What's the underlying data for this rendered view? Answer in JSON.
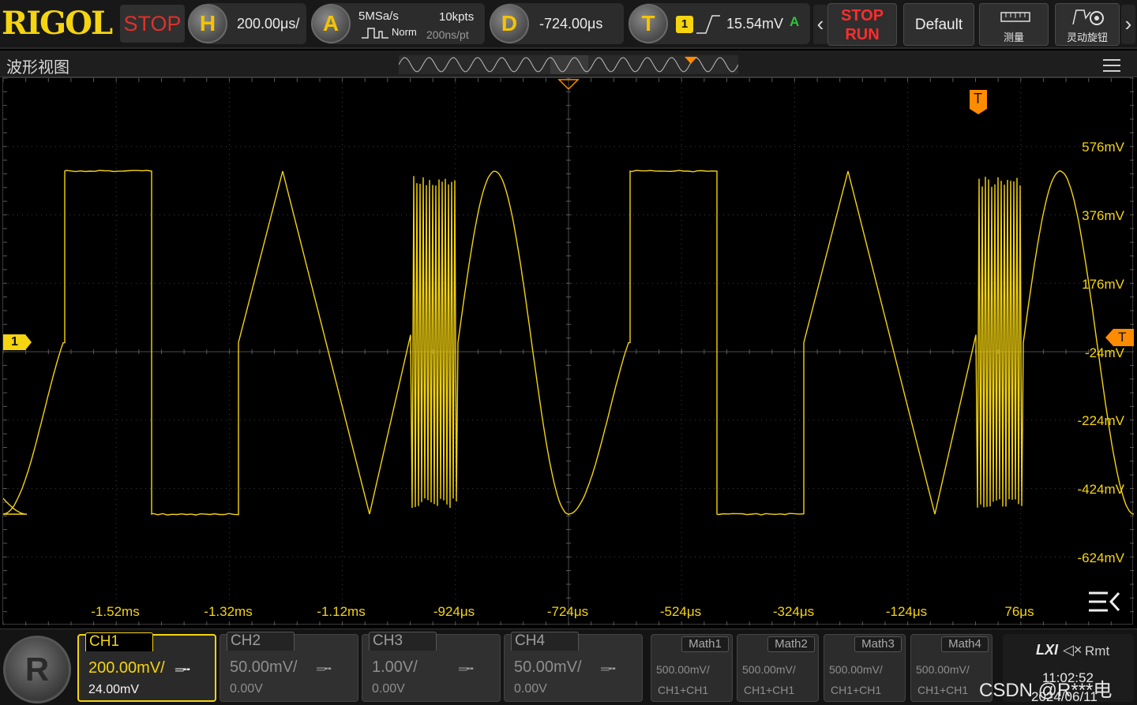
{
  "brand": "RIGOL",
  "run_state": "STOP",
  "horizontal": {
    "letter": "H",
    "timebase": "200.00μs/"
  },
  "acquire": {
    "letter": "A",
    "sample_rate": "5MSa/s",
    "memory_depth": "10kpts",
    "mode": "Norm",
    "resolution": "200ns/pt"
  },
  "delay": {
    "letter": "D",
    "value": "-724.00μs"
  },
  "trigger": {
    "letter": "T",
    "source": "1",
    "level": "15.54mV",
    "status": "A"
  },
  "buttons": {
    "stop_label": "STOP",
    "run_label": "RUN",
    "default_label": "Default",
    "measure_label": "测量",
    "knob_label": "灵动旋钮"
  },
  "view_title": "波形视图",
  "channel_marker": "1",
  "trigger_marker": "T",
  "v_labels": [
    "576mV",
    "376mV",
    "176mV",
    "-24mV",
    "-224mV",
    "-424mV",
    "-624mV"
  ],
  "t_labels": [
    "-1.52ms",
    "-1.32ms",
    "-1.12ms",
    "-924μs",
    "-724μs",
    "-524μs",
    "-324μs",
    "-124μs",
    "76μs"
  ],
  "channels": [
    {
      "name": "CH1",
      "scale": "200.00mV/",
      "offset": "24.00mV",
      "coupling": "DC",
      "active": true
    },
    {
      "name": "CH2",
      "scale": "50.00mV/",
      "offset": "0.00V",
      "coupling": "DC",
      "active": false
    },
    {
      "name": "CH3",
      "scale": "1.00V/",
      "offset": "0.00V",
      "coupling": "DC",
      "active": false
    },
    {
      "name": "CH4",
      "scale": "50.00mV/",
      "offset": "0.00V",
      "coupling": "DC",
      "active": false
    }
  ],
  "math": [
    {
      "name": "Math1",
      "scale": "500.00mV/",
      "source": "CH1+CH1"
    },
    {
      "name": "Math2",
      "scale": "500.00mV/",
      "source": "CH1+CH1"
    },
    {
      "name": "Math3",
      "scale": "500.00mV/",
      "source": "CH1+CH1"
    },
    {
      "name": "Math4",
      "scale": "500.00mV/",
      "source": "CH1+CH1"
    }
  ],
  "status": {
    "lxi": "LXI",
    "remote": "Rmt",
    "time": "11:02:52",
    "date": "2024/06/11"
  },
  "watermark": "CSDN @R***电",
  "colors": {
    "ch1": "#f5d410",
    "trigger": "#ff8c00",
    "stop": "#e0302a",
    "trig_status": "#2ec43a"
  }
}
